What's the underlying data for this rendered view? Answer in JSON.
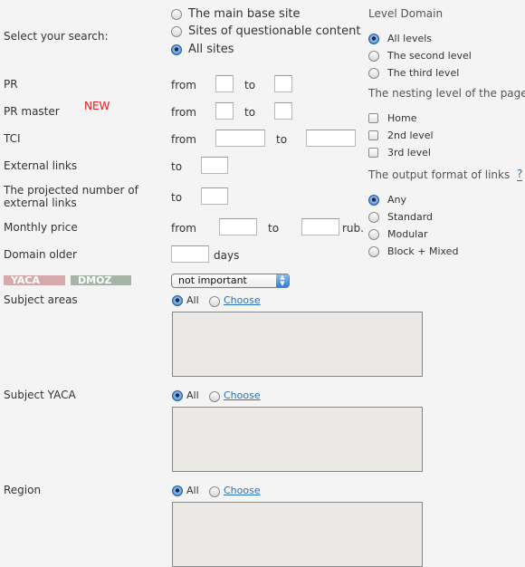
{
  "search": {
    "label": "Select your search:",
    "options": [
      "The main base site",
      "Sites of questionable content",
      "All sites"
    ],
    "selected": "All sites"
  },
  "level_domain": {
    "title": "Level Domain",
    "options": [
      "All levels",
      "The second level",
      "The third level"
    ],
    "selected": "All levels"
  },
  "nesting": {
    "title": "The nesting level of the page",
    "options": [
      "Home",
      "2nd level",
      "3rd level"
    ],
    "checked": []
  },
  "output_format": {
    "title": "The output format of links",
    "help": "?",
    "options": [
      "Any",
      "Standard",
      "Modular",
      "Block + Mixed"
    ],
    "selected": "Any"
  },
  "fields": {
    "pr": {
      "label": "PR",
      "from": "from",
      "to": "to",
      "from_value": "",
      "to_value": ""
    },
    "pr_master": {
      "label": "PR master",
      "badge": "NEW",
      "from": "from",
      "to": "to",
      "from_value": "",
      "to_value": ""
    },
    "tci": {
      "label": "TCI",
      "from": "from",
      "to": "to",
      "from_value": "",
      "to_value": ""
    },
    "external_links": {
      "label": "External links",
      "to": "to",
      "value": ""
    },
    "projected_links": {
      "label_line1": "The projected number of",
      "label_line2": "external links",
      "to": "to",
      "value": ""
    },
    "monthly_price": {
      "label": "Monthly price",
      "from": "from",
      "to": "to",
      "unit": "rub.",
      "from_value": "",
      "to_value": ""
    },
    "domain_older": {
      "label": "Domain older",
      "unit": "days",
      "value": ""
    }
  },
  "catalogs": {
    "yaca": {
      "label": "YACA",
      "color": "#d4aaad"
    },
    "dmoz": {
      "label": "DMOZ",
      "color": "#a7b5a8"
    },
    "select_value": "not important"
  },
  "subject_areas": {
    "label": "Subject areas",
    "all": "All",
    "choose": "Choose",
    "selected": "All"
  },
  "subject_yaca": {
    "label": "Subject YACA",
    "all": "All",
    "choose": "Choose",
    "selected": "All"
  },
  "region": {
    "label": "Region",
    "all": "All",
    "choose": "Choose",
    "selected": "All"
  }
}
